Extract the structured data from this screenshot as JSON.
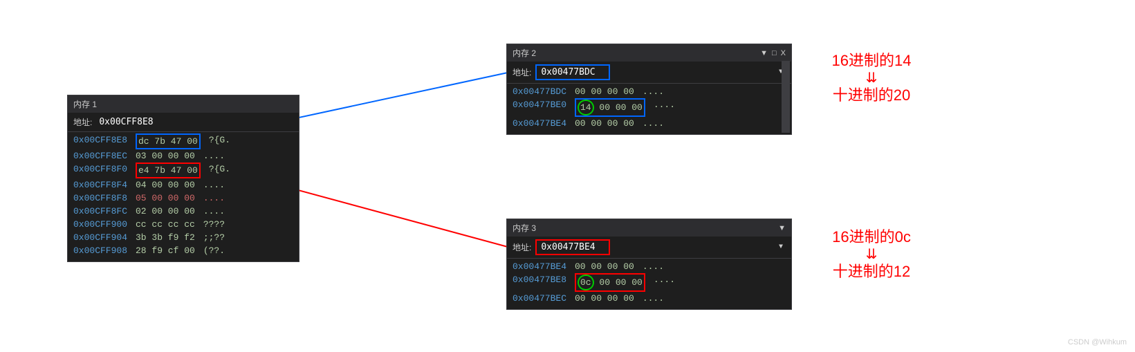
{
  "panel1": {
    "title": "内存 1",
    "addressLabel": "地址:",
    "addressValue": "0x00CFF8E8",
    "rows": [
      {
        "addr": "0x00CFF8E8",
        "bytes": "dc 7b 47 00",
        "ascii": "?{G.",
        "hl": "blue"
      },
      {
        "addr": "0x00CFF8EC",
        "bytes": "03 00 00 00",
        "ascii": "...."
      },
      {
        "addr": "0x00CFF8F0",
        "bytes": "e4 7b 47 00",
        "ascii": "?{G.",
        "hl": "red"
      },
      {
        "addr": "0x00CFF8F4",
        "bytes": "04 00 00 00",
        "ascii": "...."
      },
      {
        "addr": "0x00CFF8F8",
        "bytes": "05 00 00 00",
        "ascii": "....",
        "red": true
      },
      {
        "addr": "0x00CFF8FC",
        "bytes": "02 00 00 00",
        "ascii": "...."
      },
      {
        "addr": "0x00CFF900",
        "bytes": "cc cc cc cc",
        "ascii": "????"
      },
      {
        "addr": "0x00CFF904",
        "bytes": "3b 3b f9 f2",
        "ascii": ";;??"
      },
      {
        "addr": "0x00CFF908",
        "bytes": "28 f9 cf 00",
        "ascii": "(??."
      }
    ]
  },
  "panel2": {
    "title": "内存 2",
    "addressLabel": "地址:",
    "addressValue": "0x00477BDC",
    "rows": [
      {
        "addr": "0x00477BDC",
        "bytes": "00 00 00 00",
        "ascii": "...."
      },
      {
        "addr": "0x00477BE0",
        "bytes": "14 00 00 00",
        "ascii": "....",
        "circleFirst": true,
        "hl": "blue-tail"
      },
      {
        "addr": "0x00477BE4",
        "bytes": "00 00 00 00",
        "ascii": "...."
      }
    ]
  },
  "panel3": {
    "title": "内存 3",
    "addressLabel": "地址:",
    "addressValue": "0x00477BE4",
    "rows": [
      {
        "addr": "0x00477BE4",
        "bytes": "00 00 00 00",
        "ascii": "...."
      },
      {
        "addr": "0x00477BE8",
        "bytes": "0c 00 00 00",
        "ascii": "....",
        "circleFirst": true,
        "hl": "red-tail"
      },
      {
        "addr": "0x00477BEC",
        "bytes": "00 00 00 00",
        "ascii": "...."
      }
    ]
  },
  "annotation1": {
    "hex": "16进制的14",
    "dec": "十进制的20"
  },
  "annotation2": {
    "hex": "16进制的0c",
    "dec": "十进制的12"
  },
  "watermark": "CSDN @Wihkum",
  "icons": {
    "dropdown": "▼",
    "pin": "▾",
    "window": "□",
    "close": "X"
  }
}
